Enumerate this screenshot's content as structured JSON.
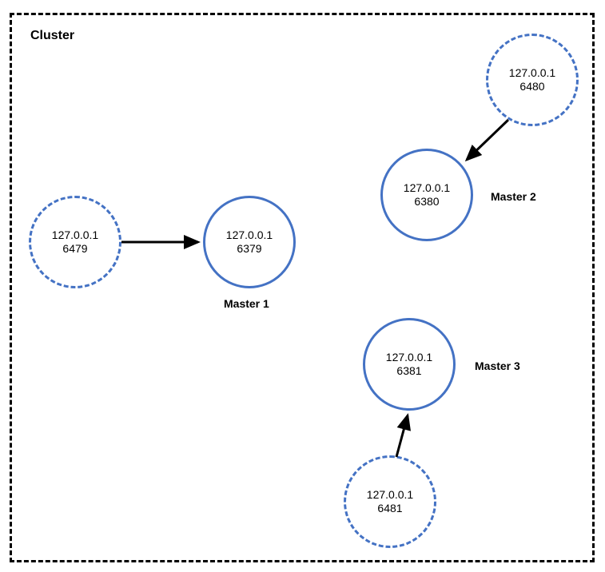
{
  "title": "Cluster",
  "nodes": {
    "slave1": {
      "ip": "127.0.0.1",
      "port": "6479"
    },
    "master1": {
      "ip": "127.0.0.1",
      "port": "6379"
    },
    "slave2": {
      "ip": "127.0.0.1",
      "port": "6480"
    },
    "master2": {
      "ip": "127.0.0.1",
      "port": "6380"
    },
    "master3": {
      "ip": "127.0.0.1",
      "port": "6381"
    },
    "slave3": {
      "ip": "127.0.0.1",
      "port": "6481"
    }
  },
  "labels": {
    "master1": "Master 1",
    "master2": "Master 2",
    "master3": "Master 3"
  },
  "colors": {
    "nodeBorder": "#4472C4",
    "arrow": "#000000",
    "clusterBorder": "#000000"
  }
}
